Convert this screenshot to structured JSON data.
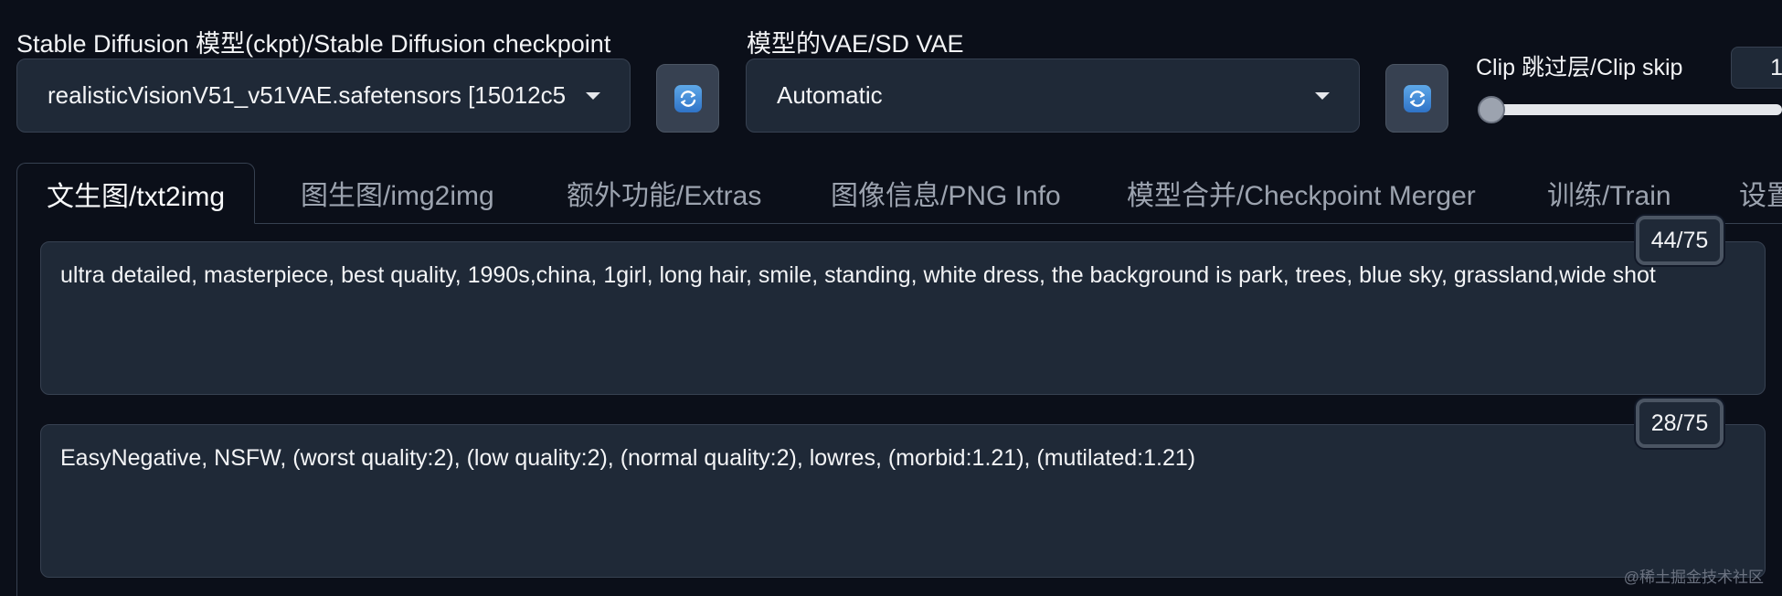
{
  "checkpoint": {
    "label": "Stable Diffusion 模型(ckpt)/Stable Diffusion checkpoint",
    "value": "realisticVisionV51_v51VAE.safetensors [15012c5"
  },
  "vae": {
    "label": "模型的VAE/SD VAE",
    "value": "Automatic"
  },
  "clip_skip": {
    "label": "Clip 跳过层/Clip skip",
    "value": "1",
    "slider_level": 0
  },
  "tabs": [
    {
      "label": "文生图/txt2img",
      "active": true
    },
    {
      "label": "图生图/img2img",
      "active": false
    },
    {
      "label": "额外功能/Extras",
      "active": false
    },
    {
      "label": "图像信息/PNG Info",
      "active": false
    },
    {
      "label": "模型合并/Checkpoint Merger",
      "active": false
    },
    {
      "label": "训练/Train",
      "active": false
    },
    {
      "label": "设置",
      "active": false
    }
  ],
  "prompt": {
    "text": "ultra detailed, masterpiece, best quality, 1990s,china, 1girl, long hair, smile,  standing, white dress, the background is park, trees, blue sky, grassland,wide shot",
    "token_count": "44/75"
  },
  "negative_prompt": {
    "text": "EasyNegative, NSFW, (worst quality:2), (low quality:2), (normal quality:2), lowres, (morbid:1.21), (mutilated:1.21)",
    "token_count": "28/75"
  },
  "watermark": "@稀土掘金技术社区",
  "icons": {
    "refresh": "refresh-icon",
    "dropdown": "chevron-down-icon"
  },
  "colors": {
    "background": "#0b0f19",
    "panel": "#1f2937",
    "border": "#374151",
    "refresh_accent": "#3b82f6"
  }
}
